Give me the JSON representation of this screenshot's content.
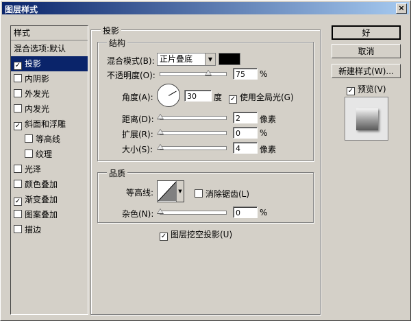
{
  "window": {
    "title": "图层样式",
    "close": "×"
  },
  "styles_panel": {
    "header": "样式",
    "items": [
      {
        "label": "混合选项:默认",
        "checkbox": false,
        "checked": false,
        "selected": false
      },
      {
        "label": "投影",
        "checkbox": true,
        "checked": true,
        "selected": true
      },
      {
        "label": "内阴影",
        "checkbox": true,
        "checked": false,
        "selected": false
      },
      {
        "label": "外发光",
        "checkbox": true,
        "checked": false,
        "selected": false
      },
      {
        "label": "内发光",
        "checkbox": true,
        "checked": false,
        "selected": false
      },
      {
        "label": "斜面和浮雕",
        "checkbox": true,
        "checked": true,
        "selected": false
      },
      {
        "label": "等高线",
        "checkbox": true,
        "checked": false,
        "selected": false
      },
      {
        "label": "纹理",
        "checkbox": true,
        "checked": false,
        "selected": false
      },
      {
        "label": "光泽",
        "checkbox": true,
        "checked": false,
        "selected": false
      },
      {
        "label": "颜色叠加",
        "checkbox": true,
        "checked": false,
        "selected": false
      },
      {
        "label": "渐变叠加",
        "checkbox": true,
        "checked": true,
        "selected": false
      },
      {
        "label": "图案叠加",
        "checkbox": true,
        "checked": false,
        "selected": false
      },
      {
        "label": "描边",
        "checkbox": true,
        "checked": false,
        "selected": false
      }
    ]
  },
  "drop_shadow": {
    "group_title": "投影",
    "structure_title": "结构",
    "blend_mode_label": "混合模式(B):",
    "blend_mode_value": "正片叠底",
    "shadow_color": "#000000",
    "opacity_label": "不透明度(O):",
    "opacity_value": "75",
    "opacity_unit": "%",
    "angle_label": "角度(A):",
    "angle_value": "30",
    "angle_unit": "度",
    "global_light_label": "使用全局光(G)",
    "global_light_checked": true,
    "distance_label": "距离(D):",
    "distance_value": "2",
    "distance_unit": "像素",
    "spread_label": "扩展(R):",
    "spread_value": "0",
    "spread_unit": "%",
    "size_label": "大小(S):",
    "size_value": "4",
    "size_unit": "像素",
    "quality_title": "品质",
    "contour_label": "等高线:",
    "antialias_label": "消除锯齿(L)",
    "antialias_checked": false,
    "noise_label": "杂色(N):",
    "noise_value": "0",
    "noise_unit": "%",
    "knockout_label": "图层挖空投影(U)",
    "knockout_checked": true
  },
  "buttons": {
    "ok": "好",
    "cancel": "取消",
    "new_style": "新建样式(W)...",
    "preview_label": "预览(V)",
    "preview_checked": true
  }
}
